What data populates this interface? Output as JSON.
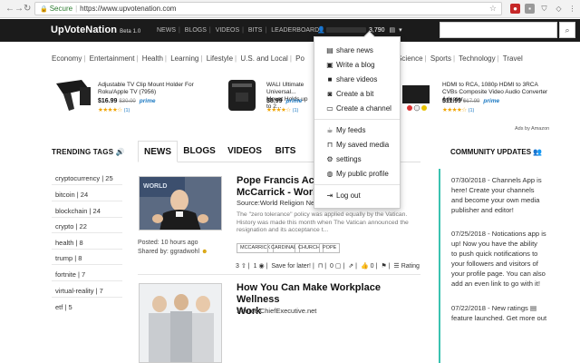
{
  "browser": {
    "secure_label": "Secure",
    "url": "https://www.upvotenation.com"
  },
  "header": {
    "logo": "UpVoteNation",
    "beta": "Beta 1.0",
    "nav": [
      "NEWS",
      "BLOGS",
      "VIDEOS",
      "BITS",
      "LEADERBOARD"
    ],
    "points": "3,790"
  },
  "categories": {
    "left": [
      "Economy",
      "Entertainment",
      "Health",
      "Learning",
      "Lifestyle",
      "U.S. and Local",
      "Po"
    ],
    "right": [
      "lity",
      "Science",
      "Sports",
      "Technology",
      "Travel"
    ]
  },
  "ads": [
    {
      "title": "Adjustable TV Clip Mount Holder For Roku/Apple TV (7956)",
      "price": "$16.99",
      "old": "$30.00",
      "prime": "prime",
      "stars": "★★★★☆",
      "count": "(1)"
    },
    {
      "title": "WALI Ultimate Universal... Mount Holds up to 2...",
      "price": "$8.99",
      "old": "",
      "prime": "prime",
      "stars": "★★★★☆",
      "count": "(1)"
    },
    {
      "title": "HDMI to RCA, 1080p HDMI to 3RCA CVBs Composite Video Audio Converter Adapter...",
      "price": "$11.99",
      "old": "$17.99",
      "prime": "prime",
      "stars": "★★★★☆",
      "count": "(1)"
    }
  ],
  "ads_by": "Ads by Amazon",
  "trending": {
    "title": "TRENDING TAGS",
    "tags": [
      "cryptocurrency | 25",
      "bitcoin | 24",
      "blockchain | 24",
      "crypto | 22",
      "health | 8",
      "trump | 8",
      "fortnite | 7",
      "virtual-reality | 7",
      "etf | 5"
    ]
  },
  "tabs": [
    "NEWS",
    "BLOGS",
    "VIDEOS",
    "BITS"
  ],
  "posts": [
    {
      "title": "Pope Francis Acce... of McCarrick - World...",
      "title_line1": "Pope Francis Acce",
      "title_line2": "McCarrick - World",
      "source": "Source:World Religion New",
      "excerpt": "The \"zero tolerance\" policy was applied equally by the Vatican. History was made this month when The Vatican announced the resignation and its acceptance t...",
      "posted": "Posted: 10 hours ago",
      "shared_by": "Shared by: ggradwohl",
      "tags": [
        "MCCARRICK",
        "CARDINAL",
        "CHURCH",
        "POPE"
      ],
      "actions": {
        "upvotes": "3",
        "views": "1",
        "save": "Save for later!",
        "comments": "0",
        "likes": "0",
        "rating": "Rating"
      }
    },
    {
      "title_line1": "How You Can Make Workplace Wellness",
      "title_line2": "Work",
      "source": "Source:ChiefExecutive.net"
    }
  ],
  "community": {
    "title": "COMMUNITY UPDATES",
    "updates": [
      [
        "07/30/2018 - Channels App is",
        "here! Create your channels",
        "and become your own media",
        "publisher and editor!"
      ],
      [
        "07/25/2018 - Notications app is",
        "up! Now you have the ability",
        "to push quick notifications to",
        "your followers and visitors of",
        "your profile page. You can also",
        "add an even link to go with it!"
      ],
      [
        "07/22/2018 - New ratings",
        "feature launched. Get more out"
      ]
    ]
  },
  "dropdown": {
    "items": [
      {
        "label": "share news",
        "icon": "newspaper-icon",
        "glyph": "▤"
      },
      {
        "label": "Write a blog",
        "icon": "document-icon",
        "glyph": "▣"
      },
      {
        "label": "share videos",
        "icon": "video-camera-icon",
        "glyph": "■"
      },
      {
        "label": "Create a bit",
        "icon": "camera-icon",
        "glyph": "◙"
      },
      {
        "label": "Create a channel",
        "icon": "monitor-icon",
        "glyph": "▭"
      },
      {
        "label": "My feeds",
        "icon": "coffee-cup-icon",
        "glyph": "☕"
      },
      {
        "label": "My saved media",
        "icon": "bookmark-icon",
        "glyph": "⊓"
      },
      {
        "label": "settings",
        "icon": "gears-icon",
        "glyph": "⚙"
      },
      {
        "label": "My public profile",
        "icon": "globe-icon",
        "glyph": "◍"
      },
      {
        "label": "Log out",
        "icon": "logout-icon",
        "glyph": "⇥"
      }
    ]
  },
  "colors": {
    "header_bg": "#1b1b1b",
    "accent_teal": "#3ac2b0",
    "prime_blue": "#1a78c2",
    "star_orange": "#f0a300"
  }
}
